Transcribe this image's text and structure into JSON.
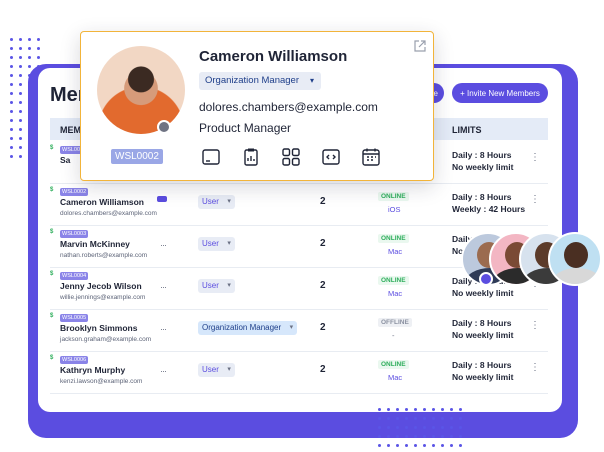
{
  "panel": {
    "title": "Mem",
    "secondary_button_label": "te",
    "invite_button_label": "+ Invite New Members"
  },
  "table": {
    "header_member": "MEMB",
    "header_limits": "LIMITS",
    "rows": [
      {
        "badge": "WSL0001",
        "name": "Sa",
        "email": "",
        "role": "",
        "count": "",
        "status": "",
        "os": "",
        "limit1": "Daily : 8 Hours",
        "limit2": "No weekly limit"
      },
      {
        "badge": "WSL0002",
        "name": "Cameron Williamson",
        "email": "dolores.chambers@example.com",
        "role": "User",
        "count": "2",
        "status": "ONLINE",
        "os": "iOS",
        "limit1": "Daily : 8 Hours",
        "limit2": "Weekly : 42 Hours"
      },
      {
        "badge": "WSL0003",
        "name": "Marvin McKinney",
        "email": "nathan.roberts@example.com",
        "role": "User",
        "count": "2",
        "status": "ONLINE",
        "os": "Mac",
        "limit1": "Daily : 8 Hours",
        "limit2": "No weekly limit"
      },
      {
        "badge": "WSL0004",
        "name": "Jenny Jecob Wilson",
        "email": "willie.jennings@example.com",
        "role": "User",
        "count": "2",
        "status": "ONLINE",
        "os": "Mac",
        "limit1": "Daily : 8 Hours",
        "limit2": "No weekly limit"
      },
      {
        "badge": "WSL0005",
        "name": "Brooklyn Simmons",
        "email": "jackson.graham@example.com",
        "role": "Organization Manager",
        "count": "2",
        "status": "OFFLINE",
        "os": "-",
        "limit1": "Daily : 8 Hours",
        "limit2": "No weekly limit"
      },
      {
        "badge": "WSL0006",
        "name": "Kathryn Murphy",
        "email": "kenzi.lawson@example.com",
        "role": "User",
        "count": "2",
        "status": "ONLINE",
        "os": "Mac",
        "limit1": "Daily : 8 Hours",
        "limit2": "No weekly limit"
      }
    ]
  },
  "popup": {
    "name": "Cameron Williamson",
    "role": "Organization Manager",
    "email": "dolores.chambers@example.com",
    "job_title": "Product Manager",
    "member_id": "WSL0002",
    "icons": [
      "screen-icon",
      "report-icon",
      "apps-icon",
      "code-icon",
      "calendar-icon"
    ]
  },
  "colors": {
    "accent": "#5b4de0",
    "online": "#2fae5c",
    "popup_border": "#f2b43a"
  }
}
